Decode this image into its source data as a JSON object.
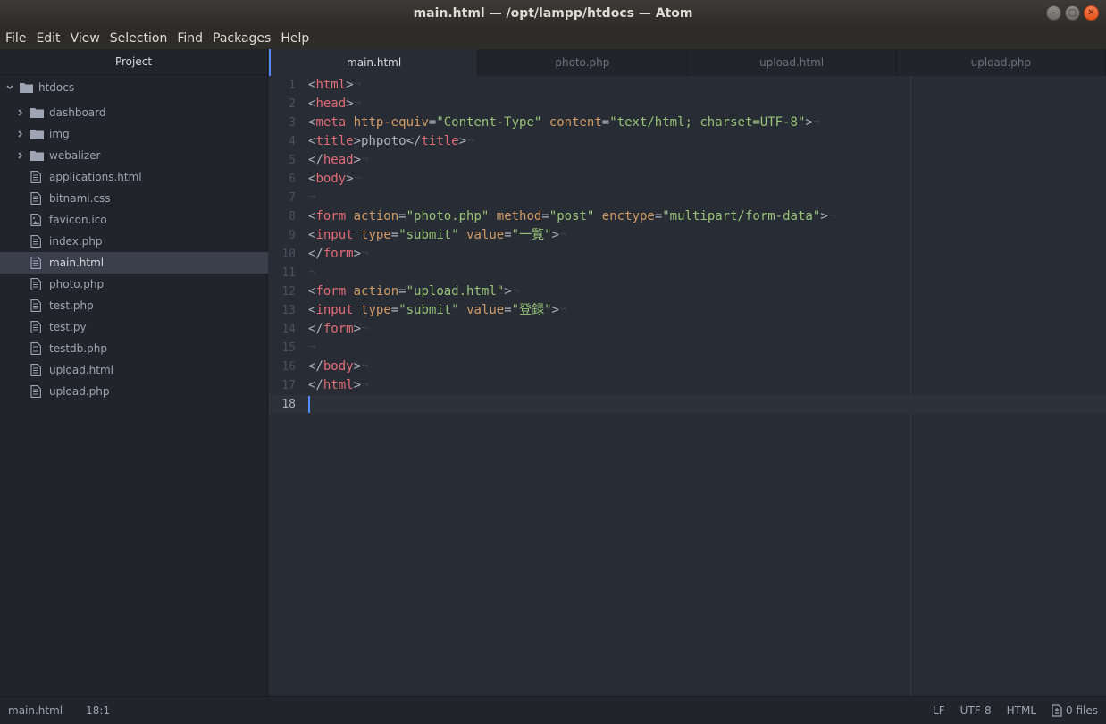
{
  "window": {
    "title": "main.html — /opt/lampp/htdocs — Atom",
    "controls": [
      "minimize",
      "maximize",
      "close"
    ]
  },
  "menu": [
    "File",
    "Edit",
    "View",
    "Selection",
    "Find",
    "Packages",
    "Help"
  ],
  "sidebar": {
    "title": "Project",
    "root": "htdocs",
    "folders": [
      "dashboard",
      "img",
      "webalizer"
    ],
    "files": [
      {
        "name": "applications.html",
        "icon": "file-text-icon"
      },
      {
        "name": "bitnami.css",
        "icon": "file-text-icon"
      },
      {
        "name": "favicon.ico",
        "icon": "file-image-icon"
      },
      {
        "name": "index.php",
        "icon": "file-text-icon"
      },
      {
        "name": "main.html",
        "icon": "file-text-icon",
        "selected": true
      },
      {
        "name": "photo.php",
        "icon": "file-text-icon"
      },
      {
        "name": "test.php",
        "icon": "file-text-icon"
      },
      {
        "name": "test.py",
        "icon": "file-text-icon"
      },
      {
        "name": "testdb.php",
        "icon": "file-text-icon"
      },
      {
        "name": "upload.html",
        "icon": "file-text-icon"
      },
      {
        "name": "upload.php",
        "icon": "file-text-icon"
      }
    ]
  },
  "tabs": [
    {
      "label": "main.html",
      "active": true
    },
    {
      "label": "photo.php",
      "active": false
    },
    {
      "label": "upload.html",
      "active": false
    },
    {
      "label": "upload.php",
      "active": false
    }
  ],
  "editor": {
    "current_line": 18,
    "eol_marker": "¬",
    "lines": [
      [
        [
          "p",
          "<"
        ],
        [
          "tag",
          "html"
        ],
        [
          "p",
          ">"
        ]
      ],
      [
        [
          "p",
          "<"
        ],
        [
          "tag",
          "head"
        ],
        [
          "p",
          ">"
        ]
      ],
      [
        [
          "p",
          "<"
        ],
        [
          "tag",
          "meta"
        ],
        [
          "t",
          " "
        ],
        [
          "attr",
          "http-equiv"
        ],
        [
          "p",
          "="
        ],
        [
          "str",
          "\"Content-Type\""
        ],
        [
          "t",
          " "
        ],
        [
          "attr",
          "content"
        ],
        [
          "p",
          "="
        ],
        [
          "str",
          "\"text/html; charset=UTF-8\""
        ],
        [
          "p",
          ">"
        ]
      ],
      [
        [
          "p",
          "<"
        ],
        [
          "tag",
          "title"
        ],
        [
          "p",
          ">"
        ],
        [
          "t",
          "phpoto"
        ],
        [
          "p",
          "</"
        ],
        [
          "tag",
          "title"
        ],
        [
          "p",
          ">"
        ]
      ],
      [
        [
          "p",
          "</"
        ],
        [
          "tag",
          "head"
        ],
        [
          "p",
          ">"
        ]
      ],
      [
        [
          "p",
          "<"
        ],
        [
          "tag",
          "body"
        ],
        [
          "p",
          ">"
        ]
      ],
      [],
      [
        [
          "p",
          "<"
        ],
        [
          "tag",
          "form"
        ],
        [
          "t",
          " "
        ],
        [
          "attr",
          "action"
        ],
        [
          "p",
          "="
        ],
        [
          "str",
          "\"photo.php\""
        ],
        [
          "t",
          " "
        ],
        [
          "attr",
          "method"
        ],
        [
          "p",
          "="
        ],
        [
          "str",
          "\"post\""
        ],
        [
          "t",
          " "
        ],
        [
          "attr",
          "enctype"
        ],
        [
          "p",
          "="
        ],
        [
          "str",
          "\"multipart/form-data\""
        ],
        [
          "p",
          ">"
        ]
      ],
      [
        [
          "p",
          "<"
        ],
        [
          "tag",
          "input"
        ],
        [
          "t",
          " "
        ],
        [
          "attr",
          "type"
        ],
        [
          "p",
          "="
        ],
        [
          "str",
          "\"submit\""
        ],
        [
          "t",
          " "
        ],
        [
          "attr",
          "value"
        ],
        [
          "p",
          "="
        ],
        [
          "str",
          "\"一覧\""
        ],
        [
          "p",
          ">"
        ]
      ],
      [
        [
          "p",
          "</"
        ],
        [
          "tag",
          "form"
        ],
        [
          "p",
          ">"
        ]
      ],
      [],
      [
        [
          "p",
          "<"
        ],
        [
          "tag",
          "form"
        ],
        [
          "t",
          " "
        ],
        [
          "attr",
          "action"
        ],
        [
          "p",
          "="
        ],
        [
          "str",
          "\"upload.html\""
        ],
        [
          "p",
          ">"
        ]
      ],
      [
        [
          "p",
          "<"
        ],
        [
          "tag",
          "input"
        ],
        [
          "t",
          " "
        ],
        [
          "attr",
          "type"
        ],
        [
          "p",
          "="
        ],
        [
          "str",
          "\"submit\""
        ],
        [
          "t",
          " "
        ],
        [
          "attr",
          "value"
        ],
        [
          "p",
          "="
        ],
        [
          "str",
          "\"登録\""
        ],
        [
          "p",
          ">"
        ]
      ],
      [
        [
          "p",
          "</"
        ],
        [
          "tag",
          "form"
        ],
        [
          "p",
          ">"
        ]
      ],
      [],
      [
        [
          "p",
          "</"
        ],
        [
          "tag",
          "body"
        ],
        [
          "p",
          ">"
        ]
      ],
      [
        [
          "p",
          "</"
        ],
        [
          "tag",
          "html"
        ],
        [
          "p",
          ">"
        ]
      ],
      null
    ]
  },
  "status": {
    "file": "main.html",
    "position": "18:1",
    "line_ending": "LF",
    "encoding": "UTF-8",
    "grammar": "HTML",
    "files": "0 files"
  }
}
